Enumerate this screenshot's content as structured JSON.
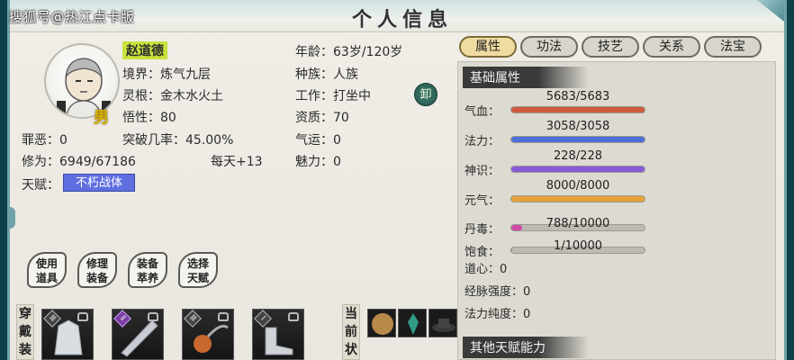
{
  "watermark": "搜狐号@热江点卡版",
  "title": "个人信息",
  "character": {
    "name": "赵道德",
    "gender": "男",
    "realm_label": "境界：",
    "realm": "炼气九层",
    "root_label": "灵根：",
    "root": "金木水火土",
    "insight_label": "悟性：",
    "insight": "80",
    "sin_label": "罪恶：",
    "sin": "0",
    "breakthrough_label": "突破几率：",
    "breakthrough": "45.00%",
    "cultivation_label": "修为：",
    "cultivation": "6949/67186",
    "daily_label": "每天+",
    "daily": "13",
    "talent_label": "天赋：",
    "talent": "不朽战体",
    "age_label": "年龄：",
    "age": "63岁/120岁",
    "race_label": "种族：",
    "race": "人族",
    "job_label": "工作：",
    "job": "打坐中",
    "aptitude_label": "资质：",
    "aptitude": "70",
    "luck_label": "气运：",
    "luck": "0",
    "charm_label": "魅力：",
    "charm": "0",
    "seal": "卸"
  },
  "actions": [
    {
      "line1": "使用",
      "line2": "道具"
    },
    {
      "line1": "修理",
      "line2": "装备"
    },
    {
      "line1": "装备",
      "line2": "萃养"
    },
    {
      "line1": "选择",
      "line2": "天赋"
    }
  ],
  "equipment": {
    "label": [
      "穿",
      "戴",
      "装"
    ],
    "badges": [
      "Ⅲ",
      "Ⅱ",
      "Ⅲ",
      "Ⅰ"
    ]
  },
  "status": {
    "label": [
      "当",
      "前",
      "状"
    ]
  },
  "tabs": [
    "属性",
    "功法",
    "技艺",
    "关系",
    "法宝"
  ],
  "active_tab": "属性",
  "basic_title": "基础属性",
  "bars": [
    {
      "label": "气血：",
      "value": "5683/5683",
      "fraction": 1.0,
      "color": "#cf5a3d"
    },
    {
      "label": "法力：",
      "value": "3058/3058",
      "fraction": 1.0,
      "color": "#4c6fd8"
    },
    {
      "label": "神识：",
      "value": "228/228",
      "fraction": 1.0,
      "color": "#8a59d6"
    },
    {
      "label": "元气：",
      "value": "8000/8000",
      "fraction": 1.0,
      "color": "#e8a13a"
    },
    {
      "label": "丹毒：",
      "value": "788/10000",
      "fraction": 0.0788,
      "color": "#d04aa8"
    },
    {
      "label": "饱食：",
      "value": "1/10000",
      "fraction": 0.0001,
      "color": "#999"
    }
  ],
  "plain_stats": [
    {
      "label": "道心：",
      "value": "0"
    },
    {
      "label": "经脉强度：",
      "value": "0"
    },
    {
      "label": "法力纯度：",
      "value": "0"
    }
  ],
  "other_title": "其他天赋能力"
}
